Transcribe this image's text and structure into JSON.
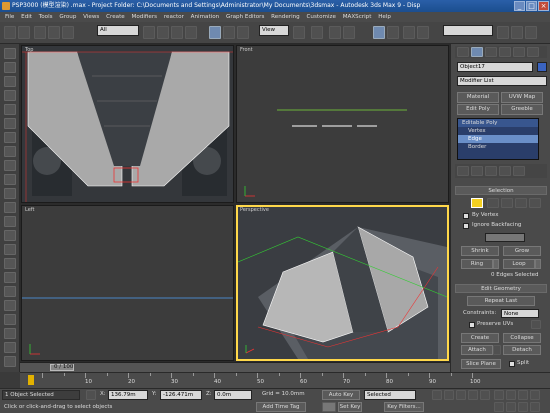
{
  "title_bar": {
    "text": "PSP3000 (模型渲染) .max   - Project Folder: C:\\Documents and Settings\\Administrator\\My Documents\\3dsmax    - Autodesk 3ds Max 9    - Disp"
  },
  "menu": [
    "File",
    "Edit",
    "Tools",
    "Group",
    "Views",
    "Create",
    "Modifiers",
    "reactor",
    "Animation",
    "Graph Editors",
    "Rendering",
    "Customize",
    "MAXScript",
    "Help"
  ],
  "toolbar": {
    "filter_value": "All",
    "refcoord_value": "View"
  },
  "viewports": {
    "top": "Top",
    "front": "Front",
    "left": "Left",
    "perspective": "Perspective"
  },
  "command_panel": {
    "object_name": "Object17",
    "modifier_list": "Modifier List",
    "buttons_row1": [
      "Material",
      "UVW Map"
    ],
    "buttons_row2": [
      "Edit Poly",
      "Greeble"
    ],
    "stack": [
      "Editable Poly",
      "Vertex",
      "Edge",
      "Border"
    ],
    "selection": {
      "title": "Selection",
      "by_vertex": "By Vertex",
      "ignore_backfacing": "Ignore Backfacing",
      "shrink": "Shrink",
      "grow": "Grow",
      "ring": "Ring",
      "loop": "Loop",
      "status": "0 Edges Selected"
    },
    "edit_geometry": {
      "title": "Edit Geometry",
      "repeat_last": "Repeat Last",
      "constraints_label": "Constraints:",
      "constraints_value": "None",
      "preserve_uvs": "Preserve UVs",
      "create": "Create",
      "collapse": "Collapse",
      "attach": "Attach",
      "detach": "Detach",
      "slice_plane": "Slice Plane",
      "split": "Split"
    }
  },
  "timeline": {
    "frame": "0 / 100",
    "ticks": [
      "10",
      "20",
      "30",
      "40",
      "50",
      "60",
      "70",
      "80",
      "90",
      "100"
    ]
  },
  "status": {
    "selected": "1 Object Selected",
    "prompt": "Click or click-and-drag to select objects",
    "x_value": "136.79m",
    "y_value": "-126.471m",
    "z_value": "0.0m",
    "grid": "Grid = 10.0mm",
    "add_time_tag": "Add Time Tag",
    "auto_key": "Auto Key",
    "set_key": "Set Key",
    "selected_dropdown": "Selected",
    "key_filters": "Key Filters..."
  },
  "colors": {
    "accent": "#ffd84a",
    "selection": "#6a8fc8",
    "titlebar": "#1b4e8f"
  }
}
